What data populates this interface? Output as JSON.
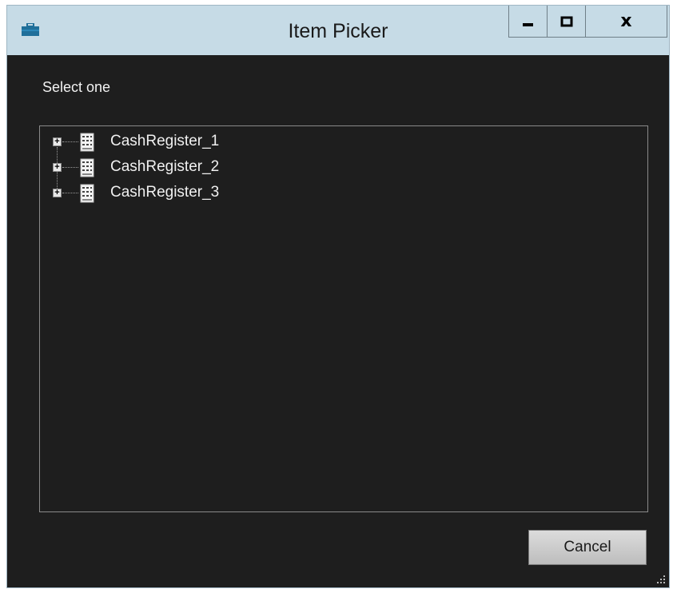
{
  "window": {
    "title": "Item Picker",
    "app_icon": "toolbox-icon",
    "controls": {
      "minimize_icon": "minimize-icon",
      "maximize_icon": "maximize-icon",
      "close_label": "x"
    }
  },
  "dialog": {
    "prompt": "Select one",
    "tree": {
      "items": [
        {
          "label": "CashRegister_1",
          "icon": "cash-register-icon",
          "expander": "+"
        },
        {
          "label": "CashRegister_2",
          "icon": "cash-register-icon",
          "expander": "+"
        },
        {
          "label": "CashRegister_3",
          "icon": "cash-register-icon",
          "expander": "+"
        }
      ]
    },
    "buttons": {
      "cancel": "Cancel"
    }
  },
  "colors": {
    "titlebar": "#c6dbe6",
    "client_background": "#1e1e1e",
    "text": "#f0f0f0",
    "app_icon": "#1f6f9a"
  }
}
